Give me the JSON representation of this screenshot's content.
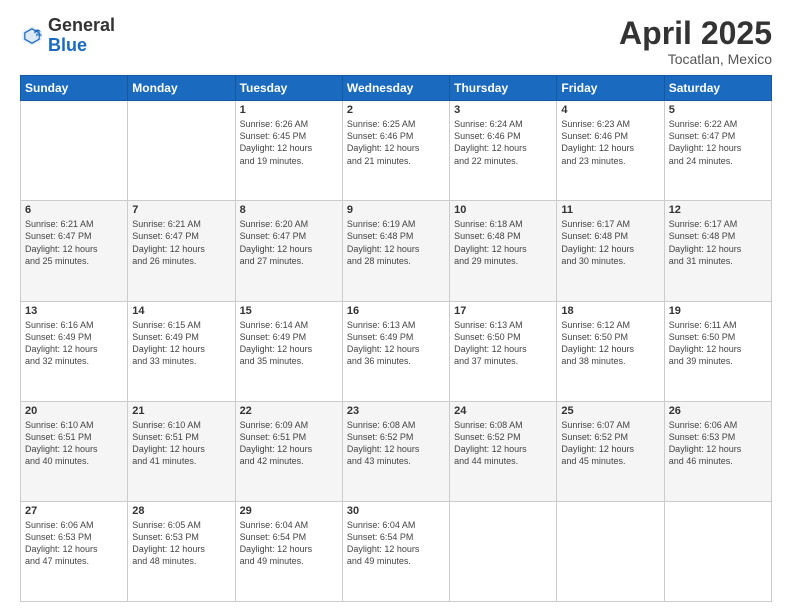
{
  "logo": {
    "general": "General",
    "blue": "Blue"
  },
  "header": {
    "month": "April 2025",
    "location": "Tocatlan, Mexico"
  },
  "days_of_week": [
    "Sunday",
    "Monday",
    "Tuesday",
    "Wednesday",
    "Thursday",
    "Friday",
    "Saturday"
  ],
  "weeks": [
    [
      {
        "day": null
      },
      {
        "day": null
      },
      {
        "day": "1",
        "sunrise": "6:26 AM",
        "sunset": "6:45 PM",
        "daylight": "12 hours and 19 minutes."
      },
      {
        "day": "2",
        "sunrise": "6:25 AM",
        "sunset": "6:46 PM",
        "daylight": "12 hours and 21 minutes."
      },
      {
        "day": "3",
        "sunrise": "6:24 AM",
        "sunset": "6:46 PM",
        "daylight": "12 hours and 22 minutes."
      },
      {
        "day": "4",
        "sunrise": "6:23 AM",
        "sunset": "6:46 PM",
        "daylight": "12 hours and 23 minutes."
      },
      {
        "day": "5",
        "sunrise": "6:22 AM",
        "sunset": "6:47 PM",
        "daylight": "12 hours and 24 minutes."
      }
    ],
    [
      {
        "day": "6",
        "sunrise": "6:21 AM",
        "sunset": "6:47 PM",
        "daylight": "12 hours and 25 minutes."
      },
      {
        "day": "7",
        "sunrise": "6:21 AM",
        "sunset": "6:47 PM",
        "daylight": "12 hours and 26 minutes."
      },
      {
        "day": "8",
        "sunrise": "6:20 AM",
        "sunset": "6:47 PM",
        "daylight": "12 hours and 27 minutes."
      },
      {
        "day": "9",
        "sunrise": "6:19 AM",
        "sunset": "6:48 PM",
        "daylight": "12 hours and 28 minutes."
      },
      {
        "day": "10",
        "sunrise": "6:18 AM",
        "sunset": "6:48 PM",
        "daylight": "12 hours and 29 minutes."
      },
      {
        "day": "11",
        "sunrise": "6:17 AM",
        "sunset": "6:48 PM",
        "daylight": "12 hours and 30 minutes."
      },
      {
        "day": "12",
        "sunrise": "6:17 AM",
        "sunset": "6:48 PM",
        "daylight": "12 hours and 31 minutes."
      }
    ],
    [
      {
        "day": "13",
        "sunrise": "6:16 AM",
        "sunset": "6:49 PM",
        "daylight": "12 hours and 32 minutes."
      },
      {
        "day": "14",
        "sunrise": "6:15 AM",
        "sunset": "6:49 PM",
        "daylight": "12 hours and 33 minutes."
      },
      {
        "day": "15",
        "sunrise": "6:14 AM",
        "sunset": "6:49 PM",
        "daylight": "12 hours and 35 minutes."
      },
      {
        "day": "16",
        "sunrise": "6:13 AM",
        "sunset": "6:49 PM",
        "daylight": "12 hours and 36 minutes."
      },
      {
        "day": "17",
        "sunrise": "6:13 AM",
        "sunset": "6:50 PM",
        "daylight": "12 hours and 37 minutes."
      },
      {
        "day": "18",
        "sunrise": "6:12 AM",
        "sunset": "6:50 PM",
        "daylight": "12 hours and 38 minutes."
      },
      {
        "day": "19",
        "sunrise": "6:11 AM",
        "sunset": "6:50 PM",
        "daylight": "12 hours and 39 minutes."
      }
    ],
    [
      {
        "day": "20",
        "sunrise": "6:10 AM",
        "sunset": "6:51 PM",
        "daylight": "12 hours and 40 minutes."
      },
      {
        "day": "21",
        "sunrise": "6:10 AM",
        "sunset": "6:51 PM",
        "daylight": "12 hours and 41 minutes."
      },
      {
        "day": "22",
        "sunrise": "6:09 AM",
        "sunset": "6:51 PM",
        "daylight": "12 hours and 42 minutes."
      },
      {
        "day": "23",
        "sunrise": "6:08 AM",
        "sunset": "6:52 PM",
        "daylight": "12 hours and 43 minutes."
      },
      {
        "day": "24",
        "sunrise": "6:08 AM",
        "sunset": "6:52 PM",
        "daylight": "12 hours and 44 minutes."
      },
      {
        "day": "25",
        "sunrise": "6:07 AM",
        "sunset": "6:52 PM",
        "daylight": "12 hours and 45 minutes."
      },
      {
        "day": "26",
        "sunrise": "6:06 AM",
        "sunset": "6:53 PM",
        "daylight": "12 hours and 46 minutes."
      }
    ],
    [
      {
        "day": "27",
        "sunrise": "6:06 AM",
        "sunset": "6:53 PM",
        "daylight": "12 hours and 47 minutes."
      },
      {
        "day": "28",
        "sunrise": "6:05 AM",
        "sunset": "6:53 PM",
        "daylight": "12 hours and 48 minutes."
      },
      {
        "day": "29",
        "sunrise": "6:04 AM",
        "sunset": "6:54 PM",
        "daylight": "12 hours and 49 minutes."
      },
      {
        "day": "30",
        "sunrise": "6:04 AM",
        "sunset": "6:54 PM",
        "daylight": "12 hours and 49 minutes."
      },
      {
        "day": null
      },
      {
        "day": null
      },
      {
        "day": null
      }
    ]
  ],
  "labels": {
    "sunrise": "Sunrise:",
    "sunset": "Sunset:",
    "daylight": "Daylight:"
  }
}
